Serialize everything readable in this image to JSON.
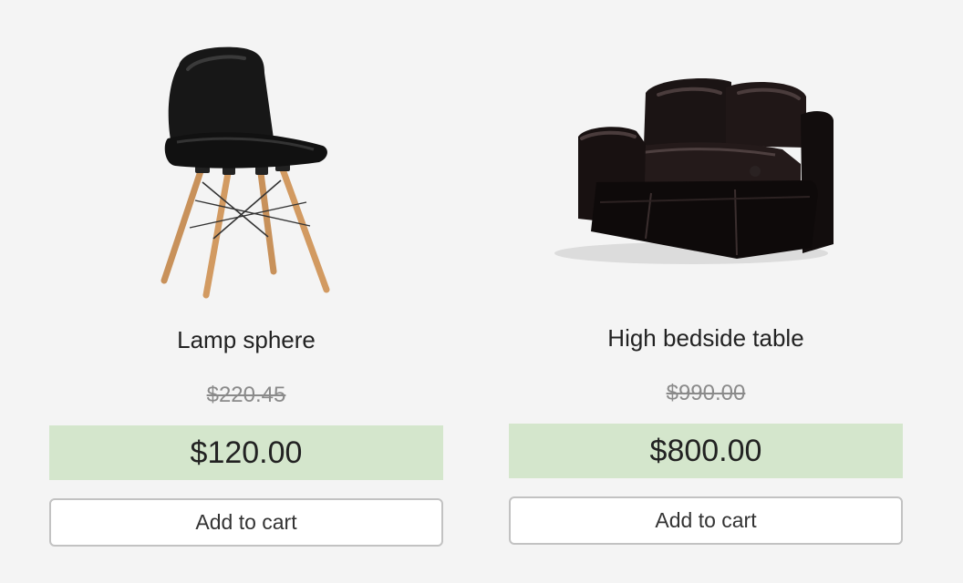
{
  "products": [
    {
      "title": "Lamp sphere",
      "old_price": "$220.45",
      "price": "$120.00",
      "button_label": "Add to cart",
      "image": "black-chair-image"
    },
    {
      "title": "High bedside table",
      "old_price": "$990.00",
      "price": "$800.00",
      "button_label": "Add to cart",
      "image": "black-leather-loveseat-image"
    }
  ],
  "colors": {
    "background": "#f4f4f4",
    "price_bar": "#d4e6cc",
    "old_price_text": "#8a8a8a",
    "button_border": "#c2c2c2"
  }
}
